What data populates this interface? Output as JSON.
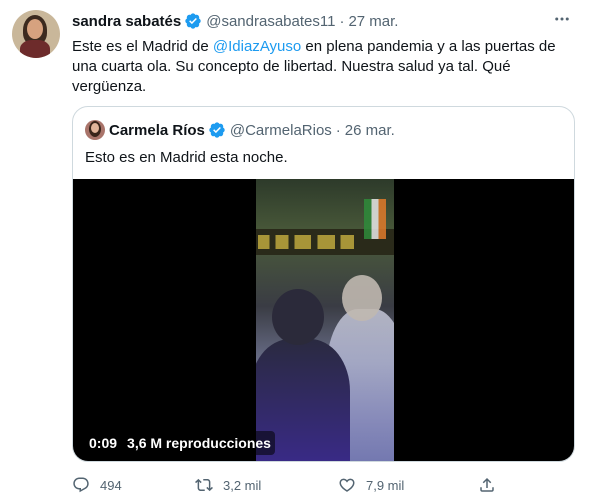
{
  "tweet": {
    "name": "sandra sabatés",
    "handle": "@sandrasabates11",
    "separator": "·",
    "date": "27 mar.",
    "text_part1": "Este es el Madrid de ",
    "mention": "@IdiazAyuso",
    "text_part2": " en plena pandemia y a las puertas de una cuarta ola. Su concepto de libertad. Nuestra salud ya tal. Qué vergüenza."
  },
  "quote": {
    "name": "Carmela Ríos",
    "handle": "@CarmelaRios",
    "separator": "·",
    "date": "26 mar.",
    "text": "Esto es en Madrid esta noche.",
    "video": {
      "duration": "0:09",
      "views": "3,6 M reproducciones"
    }
  },
  "actions": {
    "replies": "494",
    "retweets": "3,2 mil",
    "likes": "7,9 mil"
  },
  "colors": {
    "accent": "#1d9bf0",
    "muted": "#536471",
    "border": "#cfd9de"
  },
  "icons": [
    "verified-badge-icon",
    "more-options-icon",
    "reply-icon",
    "retweet-icon",
    "like-icon",
    "share-icon"
  ]
}
